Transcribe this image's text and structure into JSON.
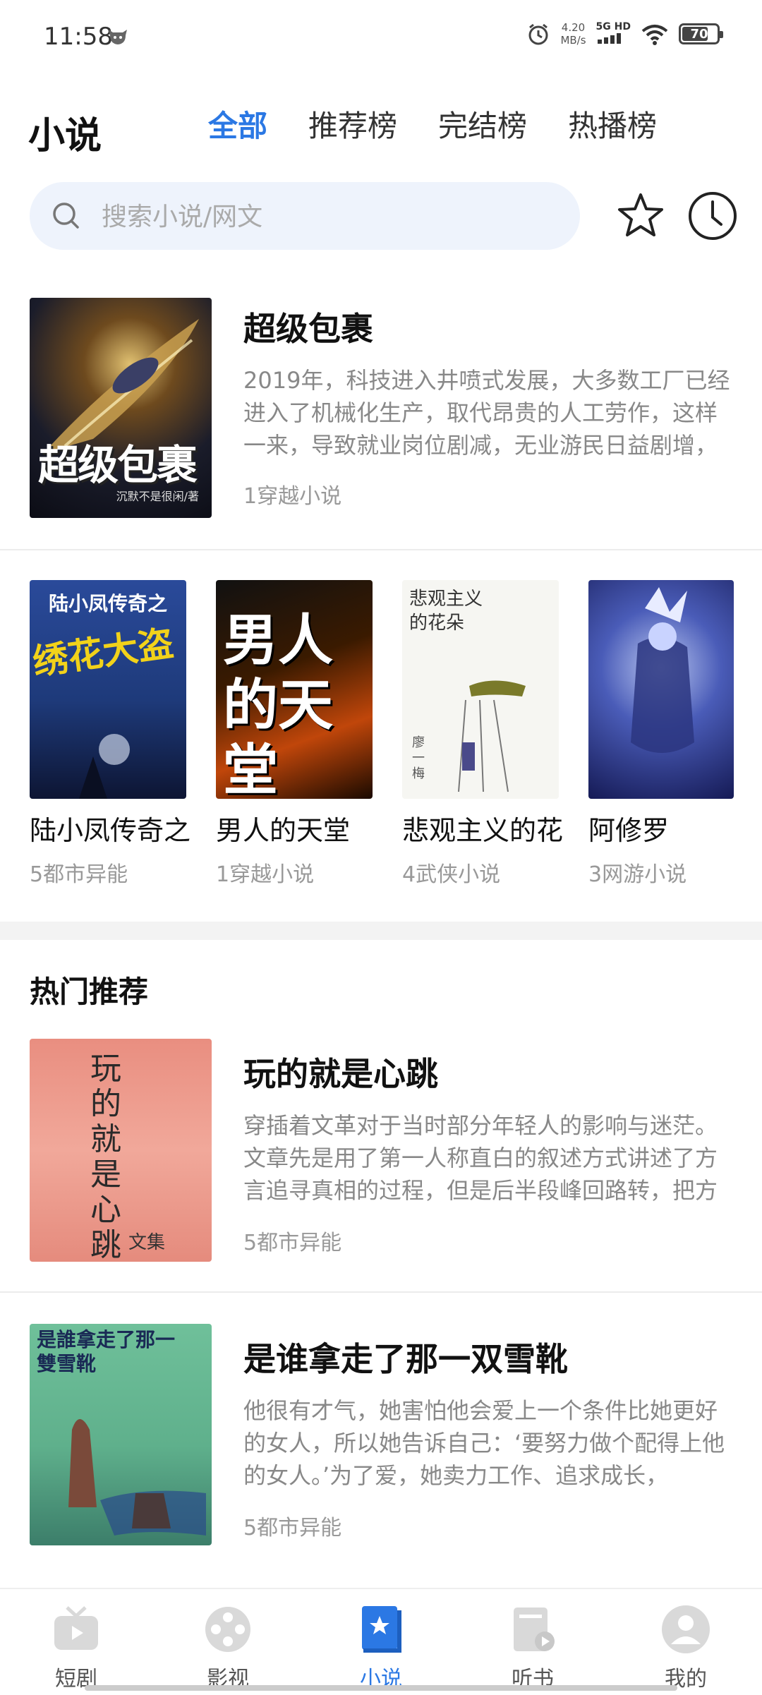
{
  "status": {
    "time": "11:58",
    "speed_value": "4.20",
    "speed_unit": "MB/s",
    "network": "5G HD",
    "battery": "70"
  },
  "header": {
    "title": "小说",
    "tabs": [
      {
        "label": "全部"
      },
      {
        "label": "推荐榜"
      },
      {
        "label": "完结榜"
      },
      {
        "label": "热播榜"
      }
    ]
  },
  "search": {
    "placeholder": "搜索小说/网文"
  },
  "featured": {
    "title": "超级包裹",
    "description": "2019年，科技进入井喷式发展，大多数工厂已经进入了机械化生产，取代昂贵的人工劳作，这样一来，导致就业岗位剧减，无业游民日益剧增，",
    "category": "1穿越小说",
    "cover_title": "超级包裹",
    "cover_author": "沉默不是很闲/著"
  },
  "grid": [
    {
      "title": "陆小凤传奇之",
      "category": "5都市异能",
      "cover_top": "陆小凤传奇之",
      "cover_main": "绣花大盗"
    },
    {
      "title": "男人的天堂",
      "category": "1穿越小说",
      "cover_main": "男人的天堂"
    },
    {
      "title": "悲观主义的花",
      "category": "4武侠小说",
      "cover_top": "悲观主义的花朵",
      "cover_author": "廖一梅"
    },
    {
      "title": "阿修罗",
      "category": "3网游小说"
    }
  ],
  "hot_section": {
    "title": "热门推荐"
  },
  "hot": [
    {
      "title": "玩的就是心跳",
      "description": "穿插着文革对于当时部分年轻人的影响与迷茫。文章先是用了第一人称直白的叙述方式讲述了方言追寻真相的过程，但是后半段峰回路转，把方",
      "category": "5都市异能",
      "cover_text": "玩的就是心跳",
      "cover_sub": "文集"
    },
    {
      "title": "是谁拿走了那一双雪靴",
      "description": "他很有才气，她害怕他会爱上一个条件比她更好的女人，所以她告诉自己：‘要努力做个配得上他的女人。’为了爱，她卖力工作、追求成长，",
      "category": "5都市异能",
      "cover_text": "是誰拿走了那一雙雪靴"
    }
  ],
  "bottom_nav": [
    {
      "label": "短剧",
      "icon": "tv-icon"
    },
    {
      "label": "影视",
      "icon": "film-reel-icon"
    },
    {
      "label": "小说",
      "icon": "book-icon"
    },
    {
      "label": "听书",
      "icon": "audiobook-icon"
    },
    {
      "label": "我的",
      "icon": "profile-icon"
    }
  ],
  "colors": {
    "accent": "#2b78e4",
    "search_bg": "#eef3fc"
  }
}
